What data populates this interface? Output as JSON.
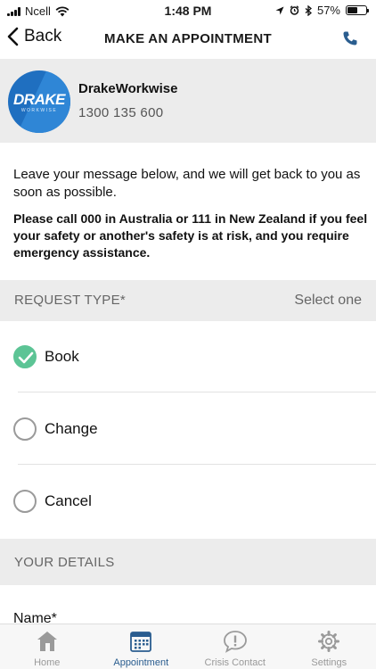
{
  "status_bar": {
    "carrier": "Ncell",
    "time": "1:48 PM",
    "battery": "57%",
    "battery_level": 0.57
  },
  "nav": {
    "back_label": "Back",
    "title": "MAKE AN APPOINTMENT",
    "call_icon": "phone-icon"
  },
  "provider": {
    "logo_text": "DRAKE",
    "logo_subtext": "WORKWISE",
    "name": "DrakeWorkwise",
    "phone": "1300 135 600"
  },
  "intro": {
    "message": "Leave your message below, and we will get back to you as soon as possible.",
    "warning": "Please call 000 in Australia or 111 in New Zealand if you feel your safety or another's safety is at risk, and you require emergency assistance."
  },
  "request_type": {
    "label": "REQUEST TYPE*",
    "value": "Select one",
    "options": [
      {
        "label": "Book",
        "selected": true
      },
      {
        "label": "Change",
        "selected": false
      },
      {
        "label": "Cancel",
        "selected": false
      }
    ]
  },
  "details": {
    "label": "YOUR DETAILS",
    "name_label": "Name*"
  },
  "tabs": [
    {
      "label": "Home",
      "icon": "home-icon",
      "active": false
    },
    {
      "label": "Appointment",
      "icon": "calendar-icon",
      "active": true
    },
    {
      "label": "Crisis Contact",
      "icon": "chat-alert-icon",
      "active": false
    },
    {
      "label": "Settings",
      "icon": "gear-icon",
      "active": false
    }
  ],
  "colors": {
    "accent": "#2a5d8f",
    "check": "#5cc495",
    "logo_blue": "#1f6fc0"
  }
}
